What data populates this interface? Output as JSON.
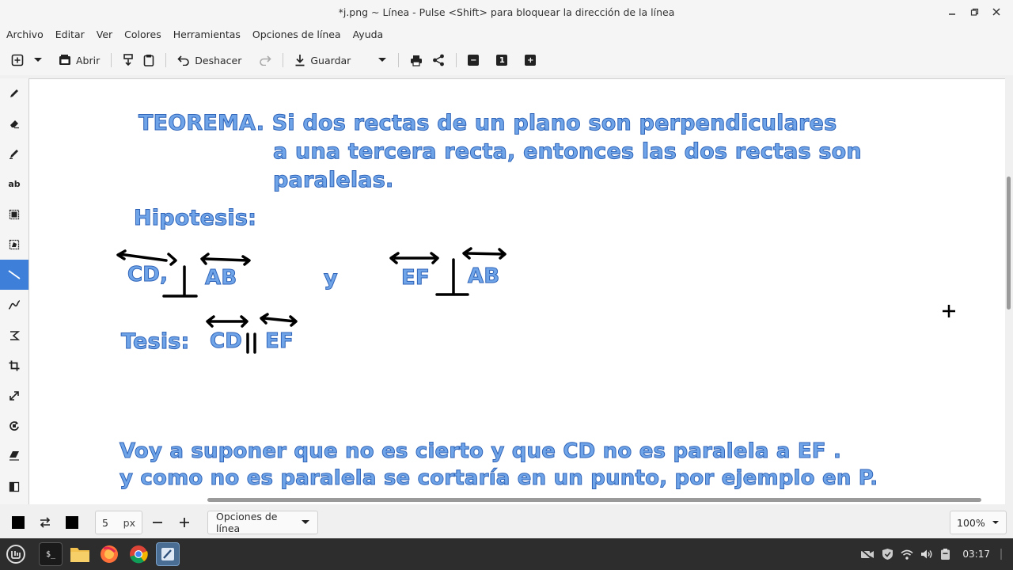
{
  "window": {
    "title": "*j.png ~ Línea - Pulse <Shift> para bloquear la dirección de la línea",
    "controls": [
      "minimize-icon",
      "maximize-icon",
      "close-icon"
    ]
  },
  "menu": [
    "Archivo",
    "Editar",
    "Ver",
    "Colores",
    "Herramientas",
    "Opciones de línea",
    "Ayuda"
  ],
  "toolbar": {
    "open_label": "Abrir",
    "undo_label": "Deshacer",
    "save_label": "Guardar",
    "zoom_one_label": "1"
  },
  "tools": [
    "pencil",
    "eraser",
    "highlighter",
    "text",
    "rectangle-select",
    "free-select",
    "line",
    "curve",
    "shape",
    "crop",
    "scale",
    "rotate",
    "skew",
    "color-filters"
  ],
  "active_tool": "line",
  "canvas": {
    "texts": {
      "theorem_line1": "TEOREMA. Si dos rectas de un plano son perpendiculares",
      "theorem_line2": "a una tercera recta, entonces las dos rectas son",
      "theorem_line3": "paralelas.",
      "hipotesis": "Hipotesis:",
      "cd1": "CD,",
      "ab1": "AB",
      "y": "y",
      "ef1": "EF",
      "ab2": "AB",
      "tesis": "Tesis:",
      "cd2": "CD",
      "ef2": "EF",
      "para_line1": "Voy a suponer que no es cierto y que CD no es paralela a EF .",
      "para_line2": "y como no es paralela se cortaría en un punto, por ejemplo en P."
    },
    "text_color": "#6fa5e8",
    "outline_color": "#2f63b8"
  },
  "bottom": {
    "size_value": "5",
    "size_unit": "px",
    "line_options_label": "Opciones de línea",
    "zoom_value": "100%",
    "primary_color": "#000000",
    "secondary_color": "#000000"
  },
  "taskbar": {
    "apps": [
      "mint-menu-icon",
      "terminal-icon",
      "files-icon",
      "firefox-icon",
      "chrome-icon",
      "pinta-icon"
    ],
    "clock": "03:17"
  }
}
